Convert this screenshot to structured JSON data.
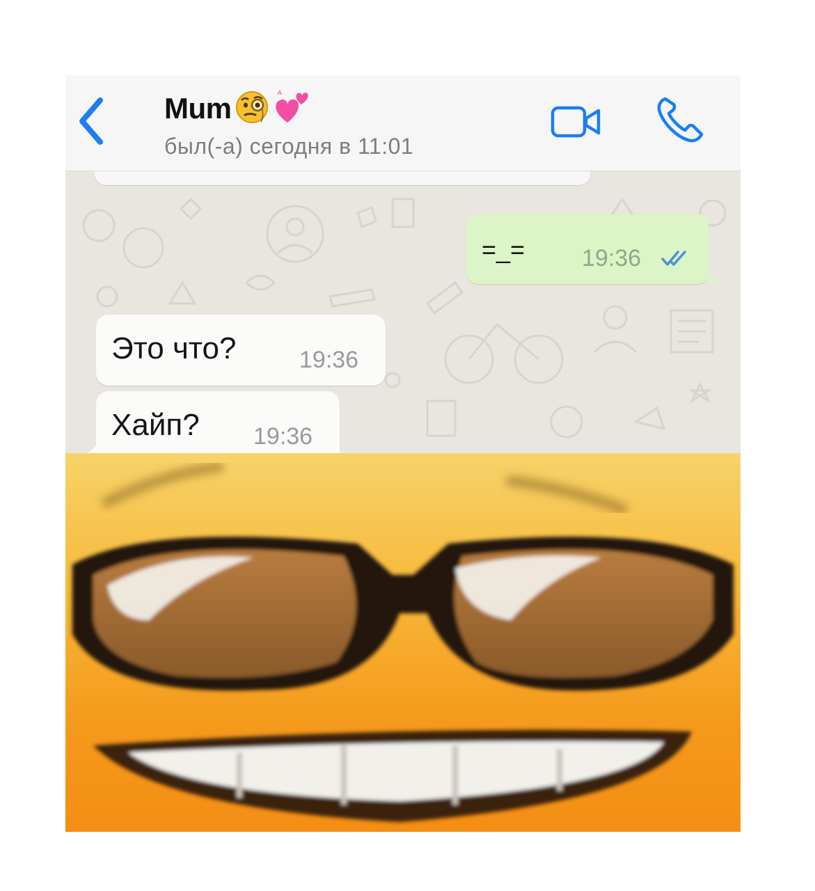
{
  "header": {
    "contact_name": "Mum",
    "last_seen": "был(-а) сегодня в 11:01",
    "icons": {
      "back": "chevron-left-icon",
      "video": "video-camera-icon",
      "call": "phone-icon",
      "emoji1": "face-with-monocle-icon",
      "emoji2": "two-hearts-icon"
    },
    "accent_color": "#1a7ff0"
  },
  "messages": [
    {
      "direction": "outgoing",
      "text": "=_=",
      "time": "19:36",
      "status": "read"
    },
    {
      "direction": "incoming",
      "text": "Это что?",
      "time": "19:36"
    },
    {
      "direction": "incoming",
      "text": "Хайп?",
      "time": "19:36"
    }
  ],
  "meme": {
    "description_icon": "sunglasses-smiling-face-icon"
  },
  "colors": {
    "outgoing_bubble": "#dcf5c6",
    "incoming_bubble": "#fbfbfa",
    "chat_background": "#e9e6e0",
    "read_ticks": "#4a90d9"
  }
}
